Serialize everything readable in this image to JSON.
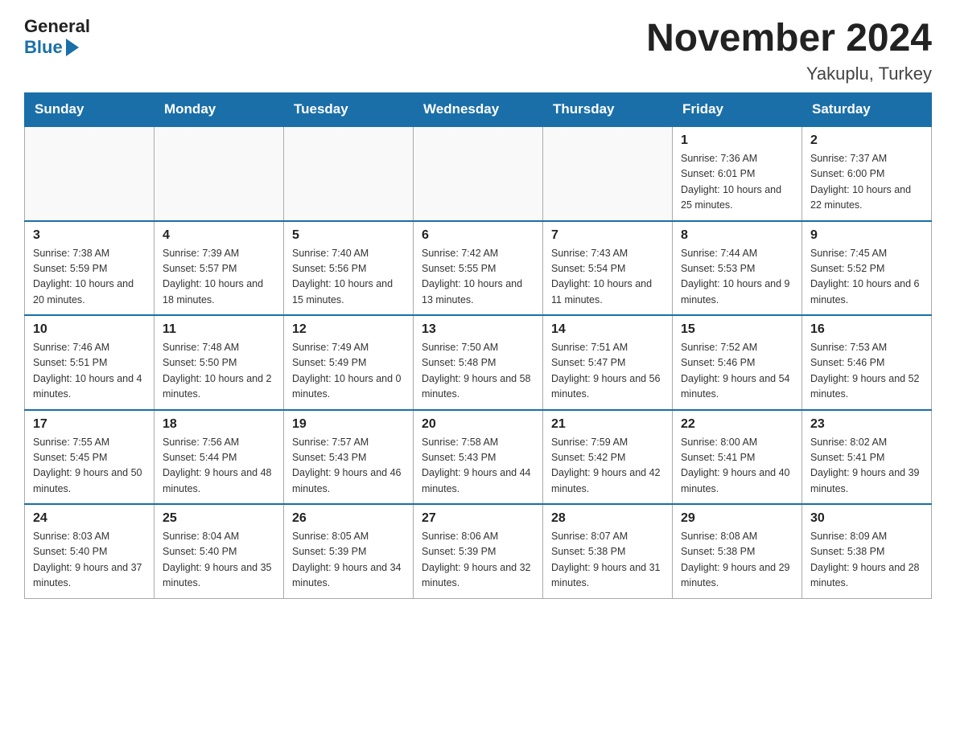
{
  "header": {
    "month_title": "November 2024",
    "location": "Yakuplu, Turkey",
    "logo_general": "General",
    "logo_blue": "Blue"
  },
  "days_of_week": [
    "Sunday",
    "Monday",
    "Tuesday",
    "Wednesday",
    "Thursday",
    "Friday",
    "Saturday"
  ],
  "weeks": [
    [
      {
        "day": "",
        "sunrise": "",
        "sunset": "",
        "daylight": ""
      },
      {
        "day": "",
        "sunrise": "",
        "sunset": "",
        "daylight": ""
      },
      {
        "day": "",
        "sunrise": "",
        "sunset": "",
        "daylight": ""
      },
      {
        "day": "",
        "sunrise": "",
        "sunset": "",
        "daylight": ""
      },
      {
        "day": "",
        "sunrise": "",
        "sunset": "",
        "daylight": ""
      },
      {
        "day": "1",
        "sunrise": "Sunrise: 7:36 AM",
        "sunset": "Sunset: 6:01 PM",
        "daylight": "Daylight: 10 hours and 25 minutes."
      },
      {
        "day": "2",
        "sunrise": "Sunrise: 7:37 AM",
        "sunset": "Sunset: 6:00 PM",
        "daylight": "Daylight: 10 hours and 22 minutes."
      }
    ],
    [
      {
        "day": "3",
        "sunrise": "Sunrise: 7:38 AM",
        "sunset": "Sunset: 5:59 PM",
        "daylight": "Daylight: 10 hours and 20 minutes."
      },
      {
        "day": "4",
        "sunrise": "Sunrise: 7:39 AM",
        "sunset": "Sunset: 5:57 PM",
        "daylight": "Daylight: 10 hours and 18 minutes."
      },
      {
        "day": "5",
        "sunrise": "Sunrise: 7:40 AM",
        "sunset": "Sunset: 5:56 PM",
        "daylight": "Daylight: 10 hours and 15 minutes."
      },
      {
        "day": "6",
        "sunrise": "Sunrise: 7:42 AM",
        "sunset": "Sunset: 5:55 PM",
        "daylight": "Daylight: 10 hours and 13 minutes."
      },
      {
        "day": "7",
        "sunrise": "Sunrise: 7:43 AM",
        "sunset": "Sunset: 5:54 PM",
        "daylight": "Daylight: 10 hours and 11 minutes."
      },
      {
        "day": "8",
        "sunrise": "Sunrise: 7:44 AM",
        "sunset": "Sunset: 5:53 PM",
        "daylight": "Daylight: 10 hours and 9 minutes."
      },
      {
        "day": "9",
        "sunrise": "Sunrise: 7:45 AM",
        "sunset": "Sunset: 5:52 PM",
        "daylight": "Daylight: 10 hours and 6 minutes."
      }
    ],
    [
      {
        "day": "10",
        "sunrise": "Sunrise: 7:46 AM",
        "sunset": "Sunset: 5:51 PM",
        "daylight": "Daylight: 10 hours and 4 minutes."
      },
      {
        "day": "11",
        "sunrise": "Sunrise: 7:48 AM",
        "sunset": "Sunset: 5:50 PM",
        "daylight": "Daylight: 10 hours and 2 minutes."
      },
      {
        "day": "12",
        "sunrise": "Sunrise: 7:49 AM",
        "sunset": "Sunset: 5:49 PM",
        "daylight": "Daylight: 10 hours and 0 minutes."
      },
      {
        "day": "13",
        "sunrise": "Sunrise: 7:50 AM",
        "sunset": "Sunset: 5:48 PM",
        "daylight": "Daylight: 9 hours and 58 minutes."
      },
      {
        "day": "14",
        "sunrise": "Sunrise: 7:51 AM",
        "sunset": "Sunset: 5:47 PM",
        "daylight": "Daylight: 9 hours and 56 minutes."
      },
      {
        "day": "15",
        "sunrise": "Sunrise: 7:52 AM",
        "sunset": "Sunset: 5:46 PM",
        "daylight": "Daylight: 9 hours and 54 minutes."
      },
      {
        "day": "16",
        "sunrise": "Sunrise: 7:53 AM",
        "sunset": "Sunset: 5:46 PM",
        "daylight": "Daylight: 9 hours and 52 minutes."
      }
    ],
    [
      {
        "day": "17",
        "sunrise": "Sunrise: 7:55 AM",
        "sunset": "Sunset: 5:45 PM",
        "daylight": "Daylight: 9 hours and 50 minutes."
      },
      {
        "day": "18",
        "sunrise": "Sunrise: 7:56 AM",
        "sunset": "Sunset: 5:44 PM",
        "daylight": "Daylight: 9 hours and 48 minutes."
      },
      {
        "day": "19",
        "sunrise": "Sunrise: 7:57 AM",
        "sunset": "Sunset: 5:43 PM",
        "daylight": "Daylight: 9 hours and 46 minutes."
      },
      {
        "day": "20",
        "sunrise": "Sunrise: 7:58 AM",
        "sunset": "Sunset: 5:43 PM",
        "daylight": "Daylight: 9 hours and 44 minutes."
      },
      {
        "day": "21",
        "sunrise": "Sunrise: 7:59 AM",
        "sunset": "Sunset: 5:42 PM",
        "daylight": "Daylight: 9 hours and 42 minutes."
      },
      {
        "day": "22",
        "sunrise": "Sunrise: 8:00 AM",
        "sunset": "Sunset: 5:41 PM",
        "daylight": "Daylight: 9 hours and 40 minutes."
      },
      {
        "day": "23",
        "sunrise": "Sunrise: 8:02 AM",
        "sunset": "Sunset: 5:41 PM",
        "daylight": "Daylight: 9 hours and 39 minutes."
      }
    ],
    [
      {
        "day": "24",
        "sunrise": "Sunrise: 8:03 AM",
        "sunset": "Sunset: 5:40 PM",
        "daylight": "Daylight: 9 hours and 37 minutes."
      },
      {
        "day": "25",
        "sunrise": "Sunrise: 8:04 AM",
        "sunset": "Sunset: 5:40 PM",
        "daylight": "Daylight: 9 hours and 35 minutes."
      },
      {
        "day": "26",
        "sunrise": "Sunrise: 8:05 AM",
        "sunset": "Sunset: 5:39 PM",
        "daylight": "Daylight: 9 hours and 34 minutes."
      },
      {
        "day": "27",
        "sunrise": "Sunrise: 8:06 AM",
        "sunset": "Sunset: 5:39 PM",
        "daylight": "Daylight: 9 hours and 32 minutes."
      },
      {
        "day": "28",
        "sunrise": "Sunrise: 8:07 AM",
        "sunset": "Sunset: 5:38 PM",
        "daylight": "Daylight: 9 hours and 31 minutes."
      },
      {
        "day": "29",
        "sunrise": "Sunrise: 8:08 AM",
        "sunset": "Sunset: 5:38 PM",
        "daylight": "Daylight: 9 hours and 29 minutes."
      },
      {
        "day": "30",
        "sunrise": "Sunrise: 8:09 AM",
        "sunset": "Sunset: 5:38 PM",
        "daylight": "Daylight: 9 hours and 28 minutes."
      }
    ]
  ]
}
